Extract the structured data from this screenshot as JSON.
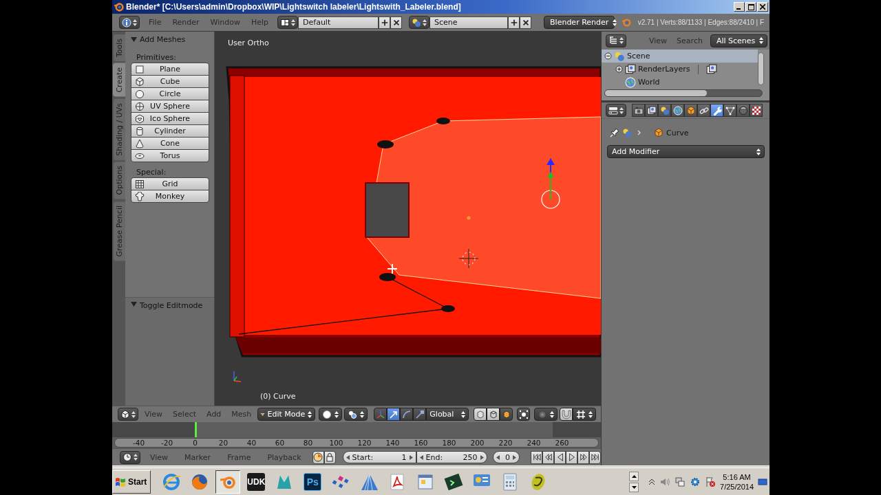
{
  "window": {
    "title": "Blender* [C:\\Users\\admin\\Dropbox\\WIP\\Lightswitch labeler\\Lightswith_Labeler.blend]"
  },
  "info_header": {
    "menus": [
      "File",
      "Render",
      "Window",
      "Help"
    ],
    "layout": "Default",
    "scene": "Scene",
    "engine": "Blender Render",
    "stats": "v2.71 | Verts:88/1133 | Edges:88/2410 | F"
  },
  "tool_tabs": [
    {
      "label": "Tools",
      "selected": false
    },
    {
      "label": "Create",
      "selected": true
    },
    {
      "label": "Shading / UVs",
      "selected": false
    },
    {
      "label": "Options",
      "selected": false
    },
    {
      "label": "Grease Pencil",
      "selected": false
    }
  ],
  "tool_panel": {
    "title": "Add Meshes",
    "expanded": true,
    "groups": [
      {
        "label": "Primitives:",
        "buttons": [
          {
            "label": "Plane",
            "kind": "plane"
          },
          {
            "label": "Cube",
            "kind": "cube"
          },
          {
            "label": "Circle",
            "kind": "circle"
          },
          {
            "label": "UV Sphere",
            "kind": "uvsphere"
          },
          {
            "label": "Ico Sphere",
            "kind": "icosphere"
          },
          {
            "label": "Cylinder",
            "kind": "cylinder"
          },
          {
            "label": "Cone",
            "kind": "cone"
          },
          {
            "label": "Torus",
            "kind": "torus"
          }
        ]
      },
      {
        "label": "Special:",
        "buttons": [
          {
            "label": "Grid",
            "kind": "grid"
          },
          {
            "label": "Monkey",
            "kind": "monkey"
          }
        ]
      }
    ]
  },
  "operator_panel": {
    "title": "Toggle Editmode",
    "expanded": true
  },
  "viewport": {
    "view_name": "User Ortho",
    "object_info": "(0) Curve"
  },
  "view3d_header": {
    "menus": [
      "View",
      "Select",
      "Add",
      "Mesh"
    ],
    "mode": "Edit Mode",
    "orientation": "Global",
    "manipulators": [
      {
        "kind": "axes",
        "selected": false
      },
      {
        "kind": "translate",
        "selected": true
      },
      {
        "kind": "rotate",
        "selected": false
      },
      {
        "kind": "scale",
        "selected": false
      }
    ]
  },
  "timeline": {
    "ticks": [
      "-40",
      "-20",
      "0",
      "20",
      "40",
      "60",
      "80",
      "100",
      "120",
      "140",
      "160",
      "180",
      "200",
      "220",
      "240",
      "260"
    ]
  },
  "timeline_header": {
    "menus": [
      "View",
      "Marker",
      "Frame",
      "Playback"
    ],
    "start_label": "Start:",
    "start": "1",
    "end_label": "End:",
    "end": "250",
    "current": "0"
  },
  "outliner": {
    "menus": [
      "View",
      "Search"
    ],
    "filter": "All Scenes",
    "tree": [
      {
        "label": "Scene",
        "kind": "scene",
        "expanded": true,
        "selected": true,
        "children": [
          {
            "label": "RenderLayers",
            "kind": "renderlayers",
            "expanded": false,
            "selected": false
          },
          {
            "label": "World",
            "kind": "world",
            "selected": false
          }
        ]
      }
    ]
  },
  "properties": {
    "tabs": [
      {
        "kind": "render",
        "selected": false
      },
      {
        "kind": "layers",
        "selected": false
      },
      {
        "kind": "scene",
        "selected": false
      },
      {
        "kind": "world",
        "selected": false
      },
      {
        "kind": "object",
        "selected": false
      },
      {
        "kind": "constraints",
        "selected": false
      },
      {
        "kind": "modifiers",
        "selected": true
      },
      {
        "kind": "data",
        "selected": false
      },
      {
        "kind": "material",
        "selected": false
      },
      {
        "kind": "texture",
        "selected": false
      }
    ],
    "breadcrumb": "Curve",
    "add_modifier": "Add Modifier"
  },
  "taskbar": {
    "start": "Start",
    "apps": [
      {
        "kind": "globe"
      },
      {
        "kind": "fox"
      },
      {
        "kind": "logo"
      },
      {
        "kind": "tile",
        "label": "UDK"
      },
      {
        "kind": "maya"
      },
      {
        "kind": "tile",
        "label": "Ps"
      },
      {
        "kind": "dots"
      },
      {
        "kind": "pyramid"
      },
      {
        "kind": "pdf"
      },
      {
        "kind": "window"
      },
      {
        "kind": "terminal"
      },
      {
        "kind": "panel"
      },
      {
        "kind": "calculator"
      },
      {
        "kind": "swirl"
      }
    ],
    "time": "5:16 AM",
    "date": "7/25/2014"
  }
}
